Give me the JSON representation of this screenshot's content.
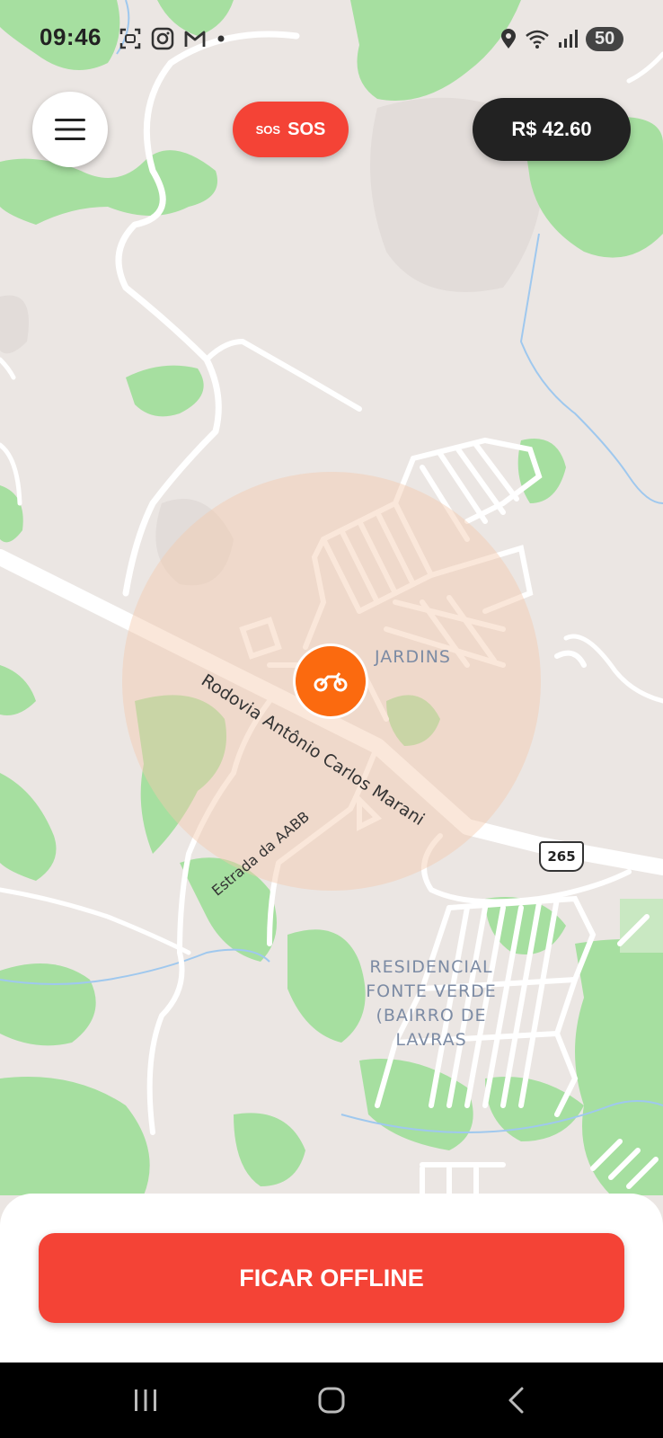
{
  "status_bar": {
    "time": "09:46",
    "battery": "50",
    "icons_left": [
      "screenshot-icon",
      "instagram-icon",
      "gmail-icon",
      "dot-icon"
    ],
    "icons_right": [
      "location-icon",
      "wifi-icon",
      "signal-icon"
    ]
  },
  "header": {
    "menu_icon": "hamburger-icon",
    "sos_icon_text": "SOS",
    "sos_label": "SOS",
    "balance": "R$ 42.60"
  },
  "map": {
    "neighborhood_1": "JARDINS",
    "neighborhood_2": [
      "RESIDENCIAL",
      "FONTE VERDE",
      "(BAIRRO DE",
      "LAVRAS"
    ],
    "road_main": "Rodovia Antônio Carlos Marani",
    "road_secondary": "Estrada da AABB",
    "route_shield": "265",
    "rider_icon": "motorcycle-icon",
    "colors": {
      "land": "#ebe6e3",
      "green": "#a6dfa0",
      "road": "#ffffff",
      "water": "#9fc8ee",
      "radius": "#f4d0b8",
      "marker": "#fb6a0f"
    }
  },
  "actions": {
    "offline_label": "FICAR OFFLINE",
    "accent": "#f44336"
  },
  "nav_bar": {
    "icons": [
      "recent-apps-icon",
      "home-icon",
      "back-icon"
    ]
  }
}
